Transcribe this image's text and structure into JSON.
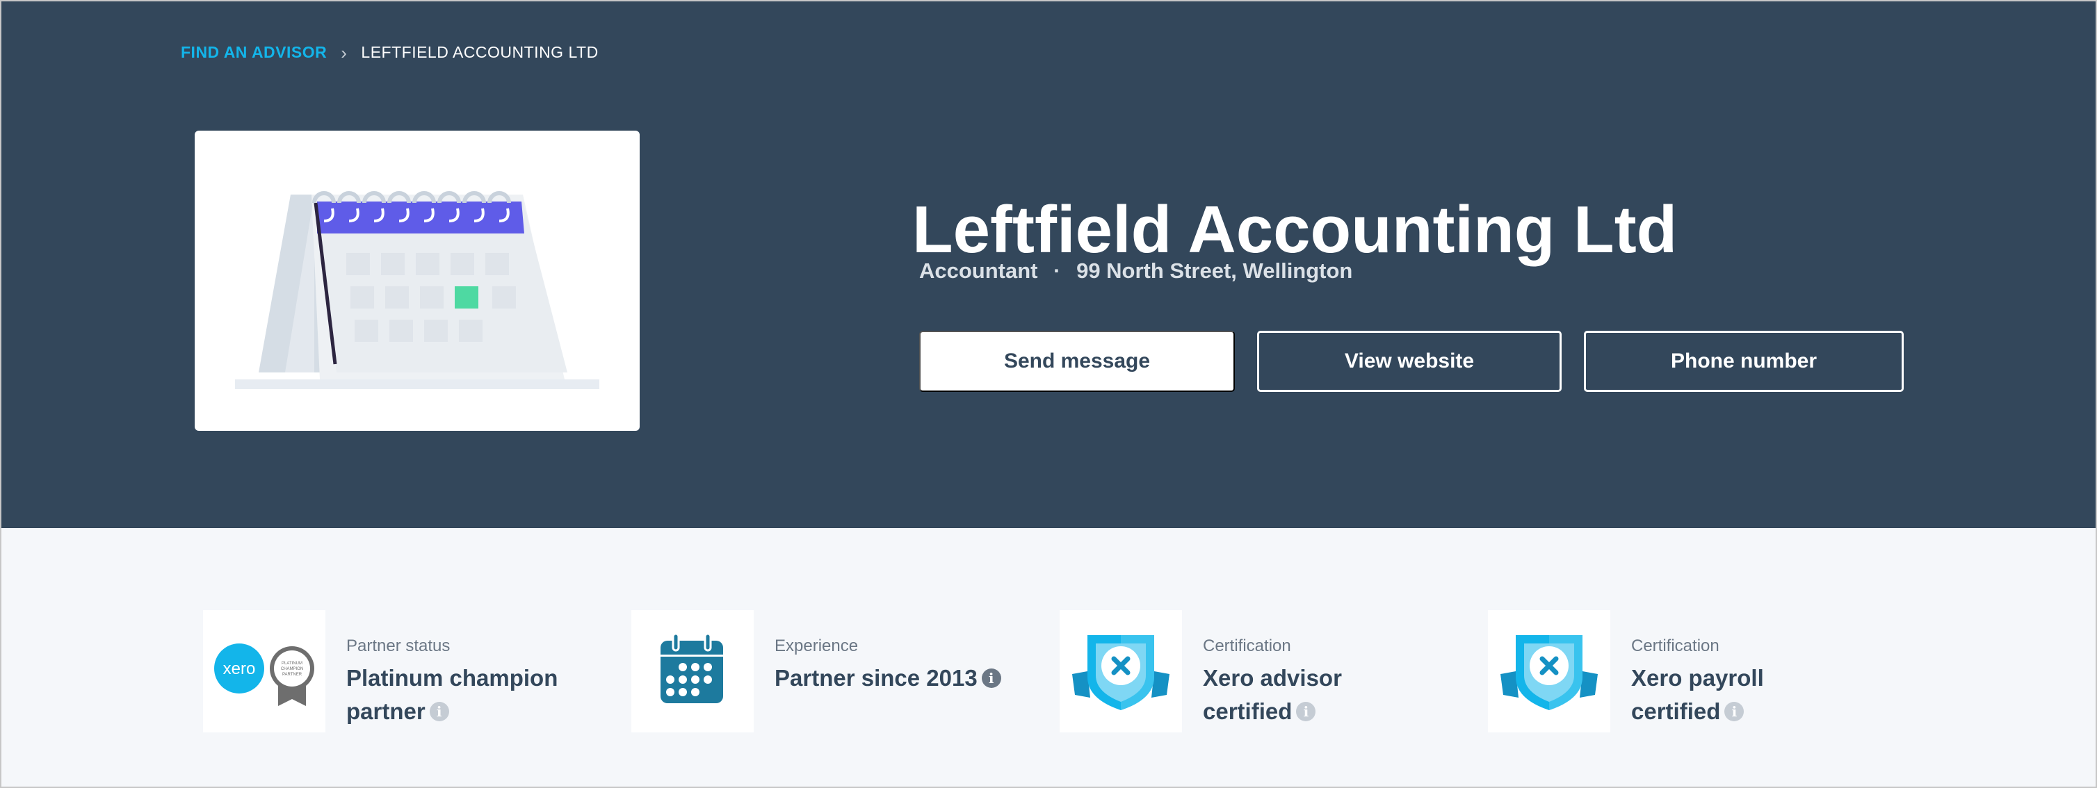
{
  "breadcrumb": {
    "link_label": "FIND AN ADVISOR",
    "separator": "›",
    "current": "LEFTFIELD ACCOUNTING LTD"
  },
  "business": {
    "name": "Leftfield Accounting Ltd",
    "category": "Accountant",
    "separator": "·",
    "address": "99 North Street, Wellington"
  },
  "actions": {
    "send_message": "Send message",
    "view_website": "View website",
    "phone_number": "Phone number"
  },
  "stats": [
    {
      "label": "Partner status",
      "value": "Platinum champion partner",
      "info": "i",
      "icon": "xero-platinum-badge-icon",
      "logo_text": "xero",
      "badge_text": "PLATINUM CHAMPION PARTNER"
    },
    {
      "label": "Experience",
      "value": "Partner since 2013",
      "info": "i",
      "icon": "calendar-icon"
    },
    {
      "label": "Certification",
      "value": "Xero advisor certified",
      "info": "i",
      "icon": "certification-shield-icon"
    },
    {
      "label": "Certification",
      "value": "Xero payroll certified",
      "info": "i",
      "icon": "certification-shield-icon"
    }
  ],
  "colors": {
    "hero_bg": "#33475b",
    "page_bg": "#f5f7fa",
    "xero_blue": "#13b5ea",
    "calendar_accent": "#5f5ce8",
    "calendar_highlight": "#4ed9a2"
  }
}
